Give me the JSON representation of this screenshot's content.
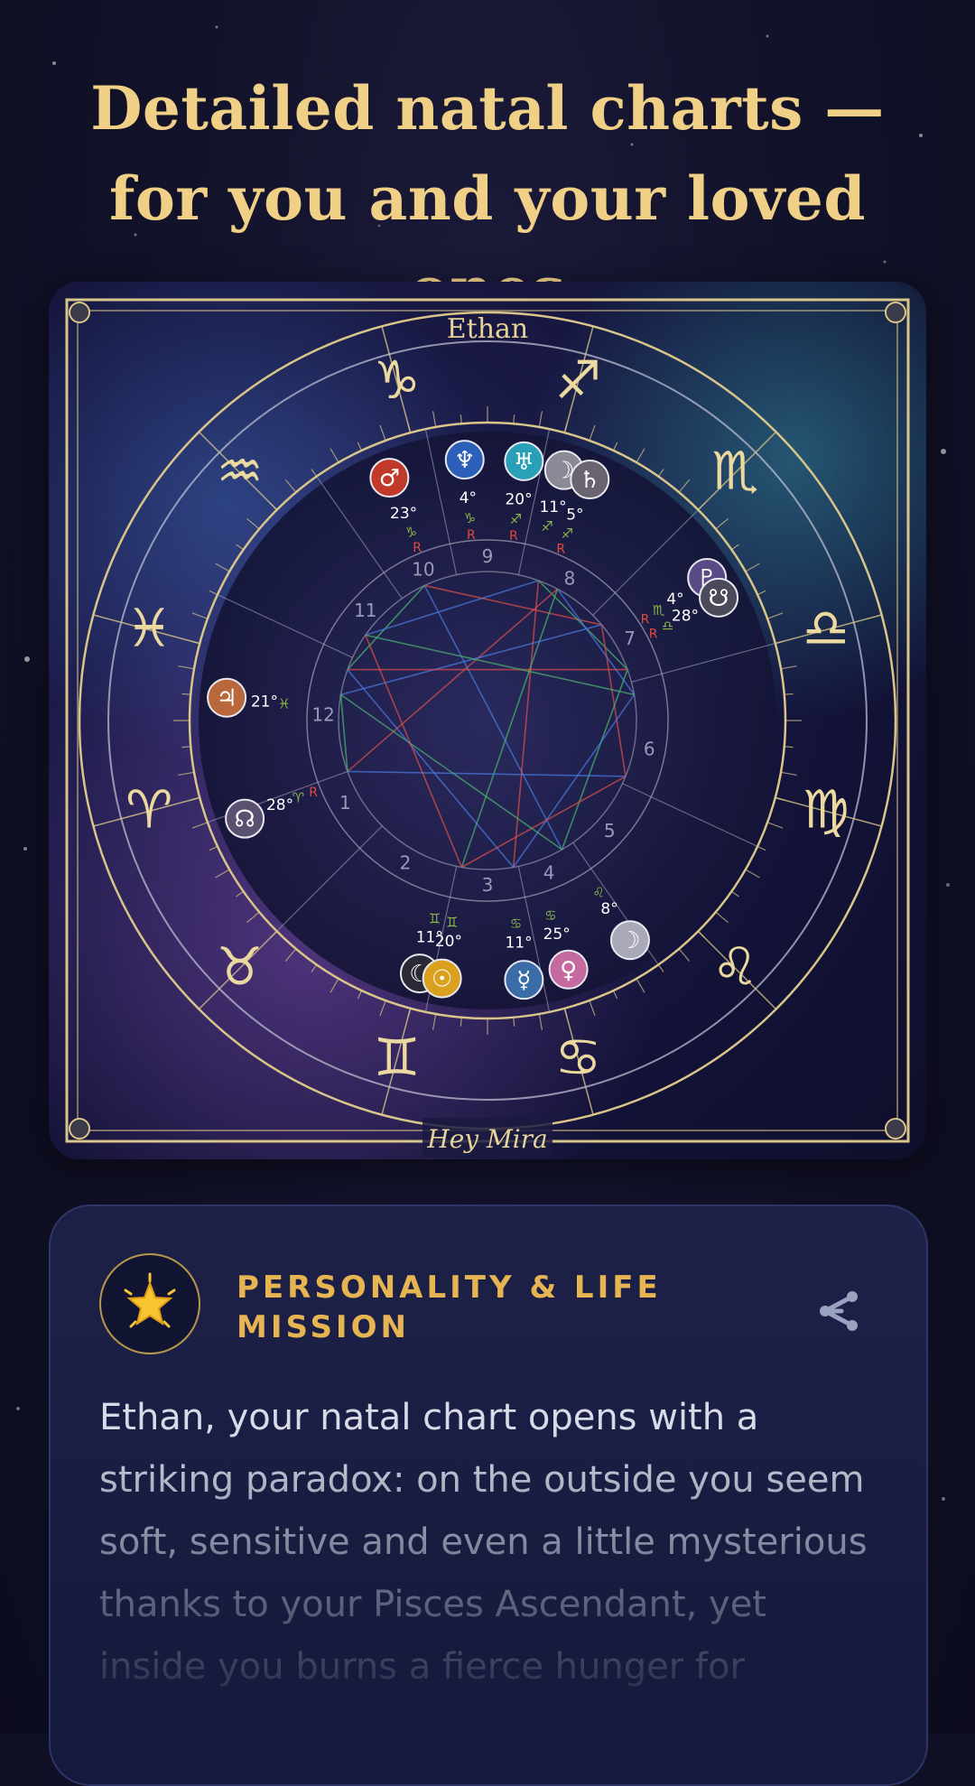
{
  "headline": "Detailed natal charts — for you and your loved ones",
  "chart": {
    "person_name": "Ethan",
    "footer_label": "Hey Mira",
    "sign_glyphs": [
      "♑",
      "♐",
      "♏",
      "♎",
      "♍",
      "♌",
      "♋",
      "♊",
      "♉",
      "♈",
      "♓",
      "♒"
    ],
    "house_numbers": [
      "1",
      "2",
      "3",
      "4",
      "5",
      "6",
      "7",
      "8",
      "9",
      "10",
      "11",
      "12"
    ],
    "planets": [
      {
        "glyph": "♂",
        "degree": "23°",
        "sign": "♑",
        "retro": "R",
        "color": "#c0392b"
      },
      {
        "glyph": "♆",
        "degree": "4°",
        "sign": "♑",
        "retro": "R",
        "color": "#2b5fb8"
      },
      {
        "glyph": "♅",
        "degree": "20°",
        "sign": "♐",
        "retro": "R",
        "color": "#2aa0b8"
      },
      {
        "glyph": "☽",
        "degree": "11°",
        "sign": "♐",
        "retro": "",
        "color": "#8a8a96"
      },
      {
        "glyph": "♄",
        "degree": "5°",
        "sign": "♐",
        "retro": "R",
        "color": "#6a6470"
      },
      {
        "glyph": "♇",
        "degree": "4°",
        "sign": "♏",
        "retro": "R",
        "color": "#5a4a86"
      },
      {
        "glyph": "☋",
        "degree": "28°",
        "sign": "♎",
        "retro": "R",
        "color": "#4a4a5a"
      },
      {
        "glyph": "♃",
        "degree": "21°",
        "sign": "♓",
        "retro": "",
        "color": "#b8683a"
      },
      {
        "glyph": "☊",
        "degree": "28°",
        "sign": "♈",
        "retro": "R",
        "color": "#5a5070"
      },
      {
        "glyph": "☾",
        "degree": "11°",
        "sign": "♊",
        "retro": "",
        "color": "#2a2a36"
      },
      {
        "glyph": "☉",
        "degree": "20°",
        "sign": "♊",
        "retro": "",
        "color": "#d9a11e"
      },
      {
        "glyph": "☿",
        "degree": "11°",
        "sign": "♋",
        "retro": "",
        "color": "#3a6ca8"
      },
      {
        "glyph": "♀",
        "degree": "25°",
        "sign": "♋",
        "retro": "",
        "color": "#c46aa0"
      },
      {
        "glyph": "☽",
        "degree": "8°",
        "sign": "♌",
        "retro": "",
        "color": "#a8a8b8"
      }
    ],
    "colors": {
      "gold": "#d9c58a",
      "aspect_red": "#e0504a",
      "aspect_blue": "#4a7ce0",
      "aspect_green": "#4ab870"
    }
  },
  "reading": {
    "badge_icon": "star-icon",
    "section_title": "PERSONALITY & LIFE MISSION",
    "share_icon": "share-icon",
    "body": "Ethan, your natal chart opens with a striking paradox: on the outside you seem soft, sensitive and even a little mysterious thanks to your Pisces Ascendant, yet inside you burns a fierce hunger for"
  }
}
